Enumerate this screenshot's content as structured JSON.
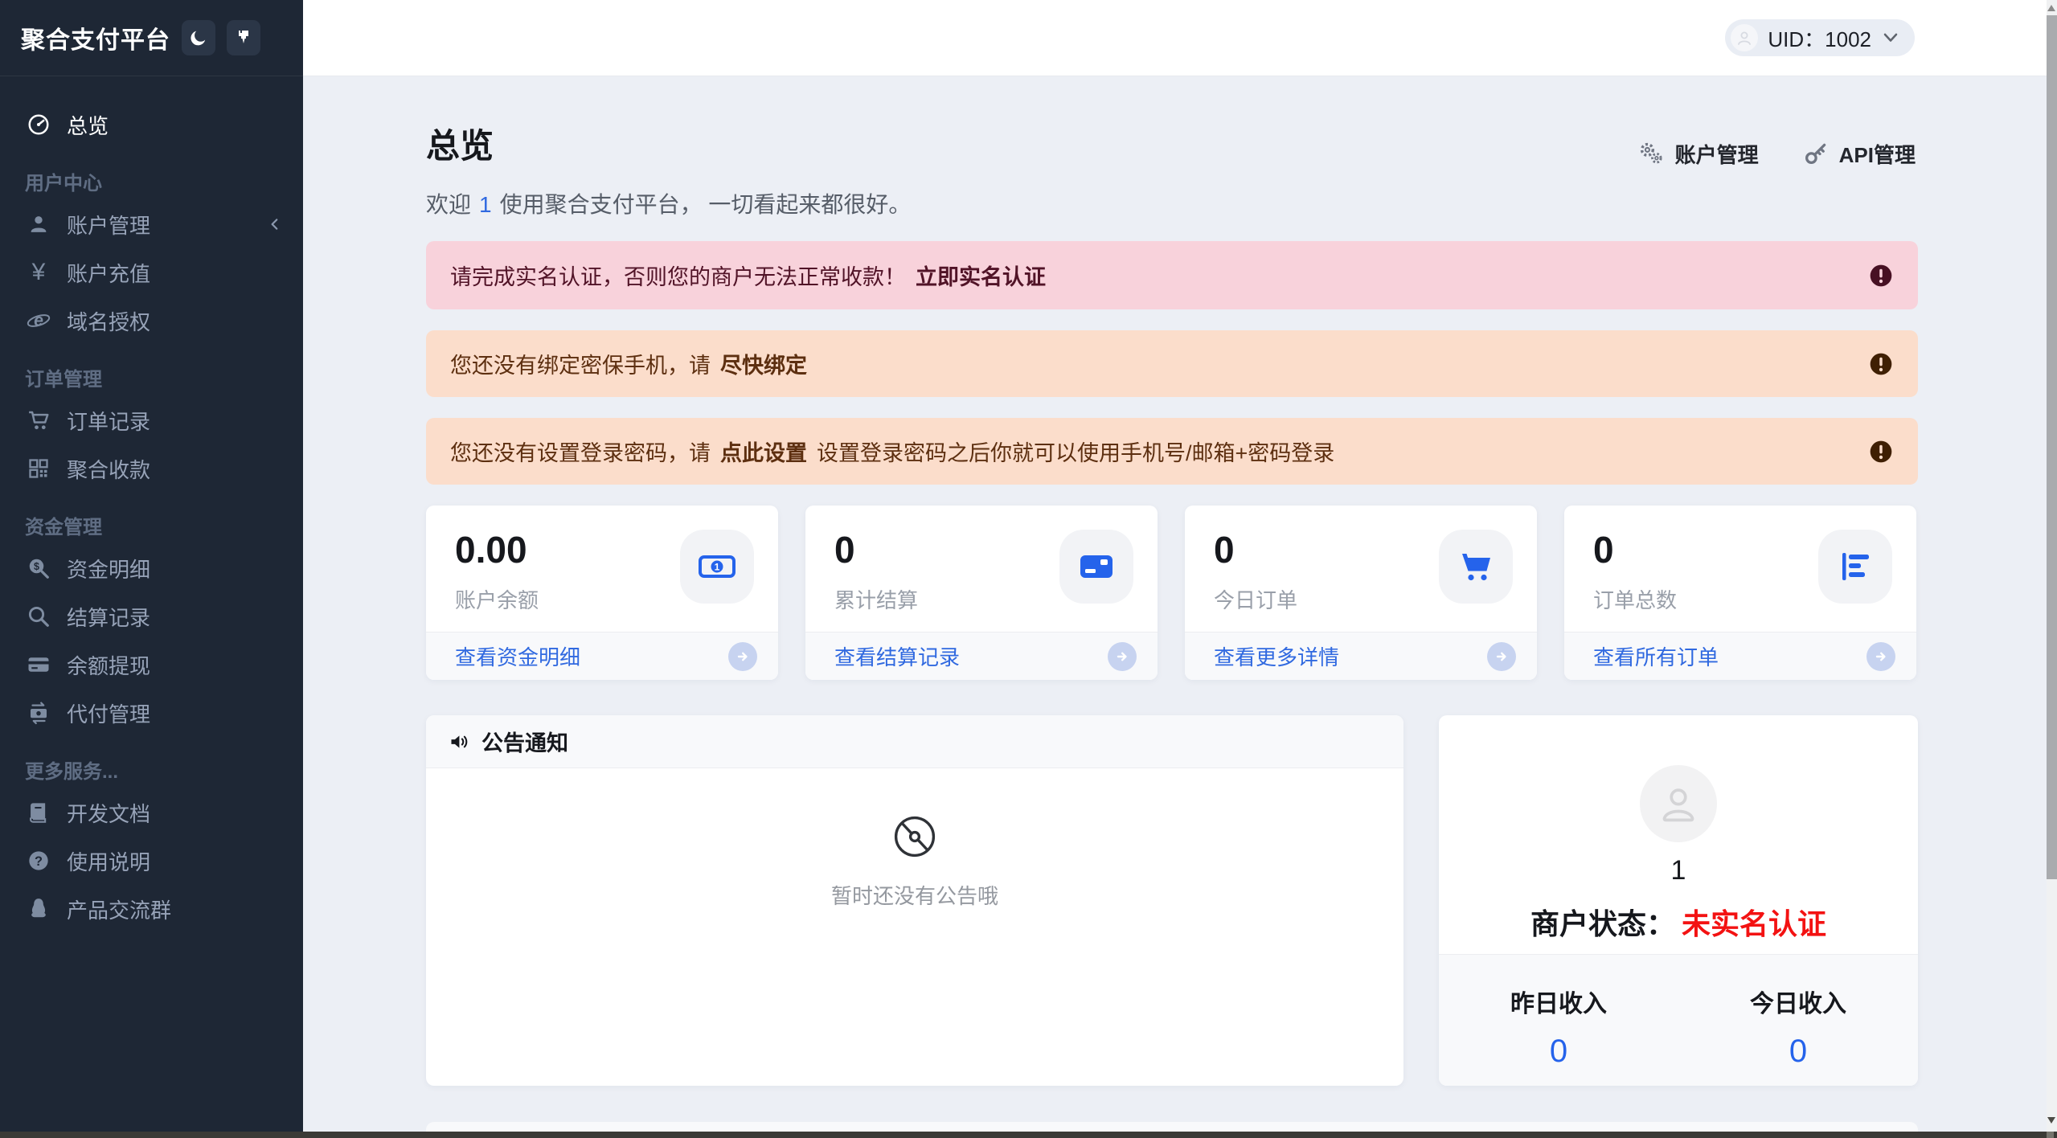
{
  "colors": {
    "accent": "#2563eb",
    "link": "#3069e0",
    "red": "#f31212",
    "danger_bg": "#f8d2db",
    "danger_text": "#511327",
    "warning_bg": "#fbddcb",
    "warning_text": "#5d2f10",
    "sidebar_bg": "#1e2735",
    "content_bg": "#eceff5"
  },
  "sidebar": {
    "logo": "聚合支付平台",
    "theme_buttons": [
      {
        "icon": "moon-icon"
      },
      {
        "icon": "brush-icon"
      }
    ],
    "sections": [
      {
        "header": "",
        "items": [
          {
            "label": "总览",
            "icon": "dashboard-icon",
            "active": true
          }
        ]
      },
      {
        "header": "用户中心",
        "items": [
          {
            "label": "账户管理",
            "icon": "user-icon",
            "collapsed": true
          },
          {
            "label": "账户充值",
            "icon": "yen-icon"
          },
          {
            "label": "域名授权",
            "icon": "ie-browser-icon"
          }
        ]
      },
      {
        "header": "订单管理",
        "items": [
          {
            "label": "订单记录",
            "icon": "cart-icon"
          },
          {
            "label": "聚合收款",
            "icon": "qrcode-icon"
          }
        ]
      },
      {
        "header": "资金管理",
        "items": [
          {
            "label": "资金明细",
            "icon": "search-dollar-icon"
          },
          {
            "label": "结算记录",
            "icon": "search-icon"
          },
          {
            "label": "余额提现",
            "icon": "credit-card-icon"
          },
          {
            "label": "代付管理",
            "icon": "money-transfer-icon"
          }
        ]
      },
      {
        "header": "更多服务...",
        "items": [
          {
            "label": "开发文档",
            "icon": "book-icon"
          },
          {
            "label": "使用说明",
            "icon": "question-icon"
          },
          {
            "label": "产品交流群",
            "icon": "qq-icon"
          }
        ]
      }
    ]
  },
  "topbar": {
    "uid": "UID：1002",
    "avatar_icon": "user-avatar-icon",
    "chevron_icon": "chevron-down-icon"
  },
  "page": {
    "title": "总览",
    "welcome": {
      "prefix": "欢迎",
      "user": "1",
      "suffix": "使用聚合支付平台， 一切看起来都很好。"
    },
    "quick_links": [
      {
        "label": "账户管理",
        "icon": "gears-icon"
      },
      {
        "label": "API管理",
        "icon": "key-icon"
      }
    ]
  },
  "alerts": [
    {
      "type": "danger",
      "text": "请完成实名认证，否则您的商户无法正常收款！",
      "action": "立即实名认证",
      "suffix": "",
      "icon": "exclamation-icon"
    },
    {
      "type": "warning",
      "text": "您还没有绑定密保手机，请",
      "action": "尽快绑定",
      "suffix": "",
      "icon": "exclamation-icon"
    },
    {
      "type": "warning",
      "text": "您还没有设置登录密码，请",
      "action": "点此设置",
      "suffix": "设置登录密码之后你就可以使用手机号/邮箱+密码登录",
      "icon": "exclamation-icon"
    }
  ],
  "stats": [
    {
      "value": "0.00",
      "label": "账户余额",
      "link": "查看资金明细",
      "icon": "money-bill-icon"
    },
    {
      "value": "0",
      "label": "累计结算",
      "link": "查看结算记录",
      "icon": "id-card-icon"
    },
    {
      "value": "0",
      "label": "今日订单",
      "link": "查看更多详情",
      "icon": "cart-icon"
    },
    {
      "value": "0",
      "label": "订单总数",
      "link": "查看所有订单",
      "icon": "bar-chart-icon"
    }
  ],
  "announcement": {
    "title": "公告通知",
    "icon": "speaker-icon",
    "empty_icon": "empty-disc-icon",
    "empty_text": "暂时还没有公告哦"
  },
  "merchant": {
    "avatar_icon": "user-avatar-icon",
    "count": "1",
    "status_label": "商户状态：",
    "status_value": "未实名认证",
    "cols": [
      {
        "label": "昨日收入",
        "value": "0"
      },
      {
        "label": "今日收入",
        "value": "0"
      }
    ]
  }
}
